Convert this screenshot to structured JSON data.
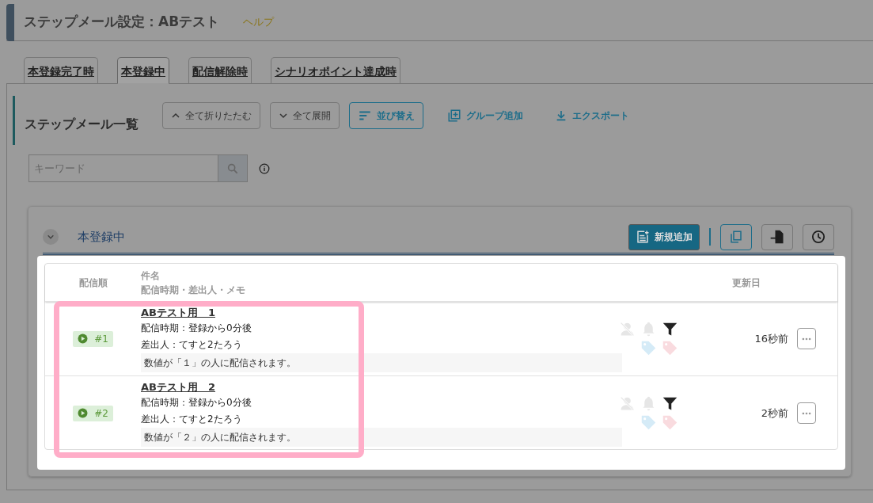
{
  "page_title": "ステップメール設定：ABテスト",
  "help_link": "ヘルプ",
  "tabs": [
    {
      "label": "本登録完了時",
      "selected": false
    },
    {
      "label": "本登録中",
      "selected": true
    },
    {
      "label": "配信解除時",
      "selected": false
    },
    {
      "label": "シナリオポイント達成時",
      "selected": false
    }
  ],
  "section_title": "ステップメール一覧",
  "toolbar": [
    {
      "kind": "outline",
      "label": "全て折りたたむ"
    },
    {
      "kind": "outline",
      "label": "全て展開"
    },
    {
      "kind": "primary-outline",
      "label": "並び替え"
    },
    {
      "kind": "link",
      "label": "グループ追加"
    },
    {
      "kind": "link",
      "label": "エクスポート"
    }
  ],
  "search": {
    "placeholder": "キーワード"
  },
  "group": {
    "title": "本登録中",
    "expanded": true,
    "add_button": "新規追加"
  },
  "table": {
    "columns": [
      "配信順",
      "件名",
      "配信時期・差出人・メモ",
      "更新日"
    ],
    "rows": [
      {
        "order": "#1",
        "subject": "ABテスト用　1",
        "timing": "配信時期：登録から0分後",
        "sender": "差出人：てすと2たろう",
        "memo": "数値が「１」の人に配信されます。",
        "indicators": [
          {
            "kind": "user-off",
            "on": false
          },
          {
            "kind": "bell",
            "on": false
          },
          {
            "kind": "filter",
            "on": true
          },
          {
            "kind": "tag",
            "color": "#d5ebf7"
          },
          {
            "kind": "tag",
            "color": "#f9dbdf"
          }
        ],
        "updated": "16秒前"
      },
      {
        "order": "#2",
        "subject": "ABテスト用　2",
        "timing": "配信時期：登録から0分後",
        "sender": "差出人：てすと2たろう",
        "memo": "数値が「２」の人に配信されます。",
        "indicators": [
          {
            "kind": "user-off",
            "on": false
          },
          {
            "kind": "bell",
            "on": false
          },
          {
            "kind": "filter",
            "on": true
          },
          {
            "kind": "tag",
            "color": "#d5ebf7"
          },
          {
            "kind": "tag",
            "color": "#f9dbdf"
          }
        ],
        "updated": "2秒前"
      }
    ]
  }
}
